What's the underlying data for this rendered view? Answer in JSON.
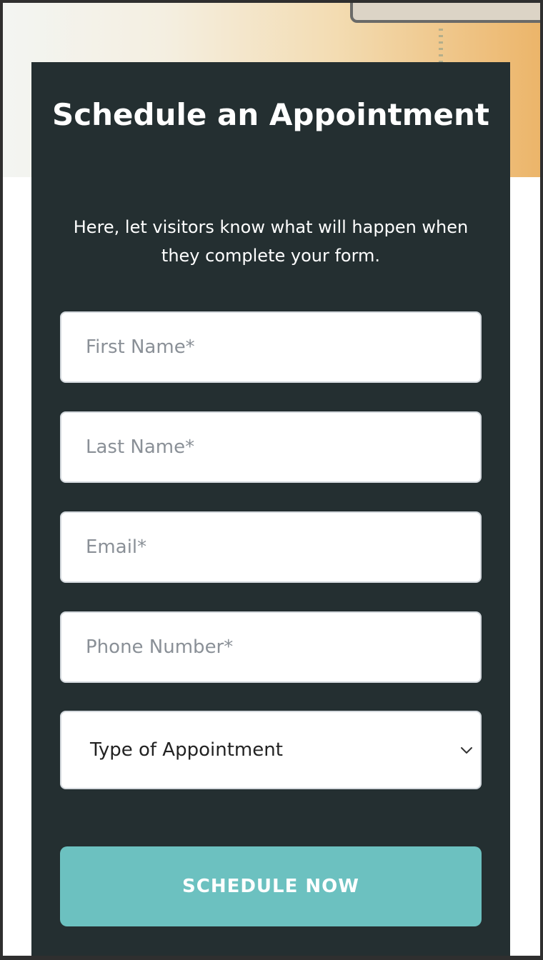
{
  "colors": {
    "card_background": "#242f31",
    "button_background": "#6cc1c0",
    "input_border": "#d3d8dd",
    "placeholder_text": "#8a9097"
  },
  "form": {
    "title": "Schedule an Appointment",
    "description": "Here, let visitors know what will happen when they complete your form.",
    "fields": {
      "first_name": {
        "placeholder": "First Name*",
        "value": ""
      },
      "last_name": {
        "placeholder": "Last Name*",
        "value": ""
      },
      "email": {
        "placeholder": "Email*",
        "value": ""
      },
      "phone": {
        "placeholder": "Phone Number*",
        "value": ""
      }
    },
    "appointment_type": {
      "selected": "Type of Appointment",
      "icon": "chevron-down-icon"
    },
    "submit_label": "SCHEDULE NOW"
  }
}
